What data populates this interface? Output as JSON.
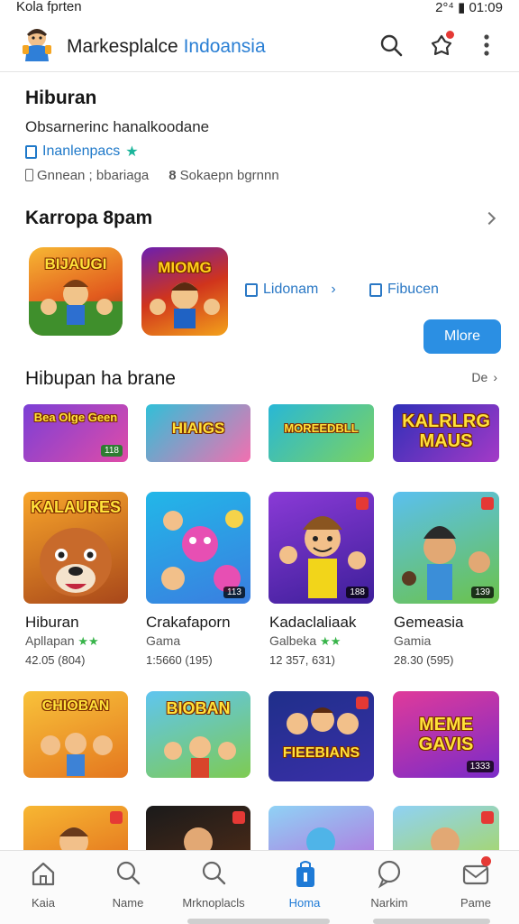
{
  "status_bar": {
    "carrier": "Kola fprten",
    "time": "2°⁴ ▮ 01:09"
  },
  "header": {
    "title_main": "Markesplalce",
    "title_accent": "Indoansia"
  },
  "info": {
    "title": "Hiburan",
    "subtitle": "Obsarnerinc hanalkoodane",
    "link_label": "Inanlenpacs",
    "meta_left": "Gnnean ; bbariaga",
    "meta_right": "Sokaepn bgrnnn"
  },
  "featured": {
    "title": "Karropa 8pam",
    "tiles": [
      {
        "label": "BIJAUGI"
      },
      {
        "label": "MIOMG"
      }
    ],
    "links": [
      {
        "label": "Lidonam"
      },
      {
        "label": "Fibucen"
      }
    ],
    "more_button": "Mlore"
  },
  "games_section": {
    "title": "Hibupan ha brane",
    "see_all": "De",
    "banners": [
      {
        "label": "Bea Olge Geen",
        "tag": "118"
      },
      {
        "label": "HIAIGS",
        "tag": ""
      },
      {
        "label": "MOREEDBLL",
        "tag": ""
      },
      {
        "label": "KALRLRG MAUS",
        "tag": ""
      }
    ],
    "cards": [
      {
        "label": "KALAURES",
        "name": "Hiburan",
        "category": "Apllapan",
        "stars": "★★",
        "count": "42.05 (804)",
        "tag": ""
      },
      {
        "label": "",
        "name": "Crakafaporn",
        "category": "Gama",
        "stars": "",
        "count": "1:5660 (195)",
        "tag": "113"
      },
      {
        "label": "",
        "name": "Kadaclaliaak",
        "category": "Galbeka",
        "stars": "★★",
        "count": "12 357, 631)",
        "tag": "188"
      },
      {
        "label": "",
        "name": "Gemeasia",
        "category": "Gamia",
        "stars": "",
        "count": "28.30 (595)",
        "tag": "139"
      }
    ],
    "row3": [
      {
        "label": "CHIOBAN",
        "tag": ""
      },
      {
        "label": "BIOBAN",
        "tag": ""
      },
      {
        "label": "FIEEBIANS",
        "tag": ""
      },
      {
        "label": "MEME GAVIS",
        "tag": "1333"
      }
    ]
  },
  "bottom_nav": [
    {
      "label": "Kaia",
      "icon": "home-icon"
    },
    {
      "label": "Name",
      "icon": "search-icon"
    },
    {
      "label": "Mrknoplacls",
      "icon": "search-icon"
    },
    {
      "label": "Homa",
      "icon": "bag-icon"
    },
    {
      "label": "Narkim",
      "icon": "chat-icon"
    },
    {
      "label": "Pame",
      "icon": "mail-icon"
    }
  ],
  "colors": {
    "accent": "#2b8fe3",
    "link": "#1f79c9",
    "badge": "#e53935"
  }
}
